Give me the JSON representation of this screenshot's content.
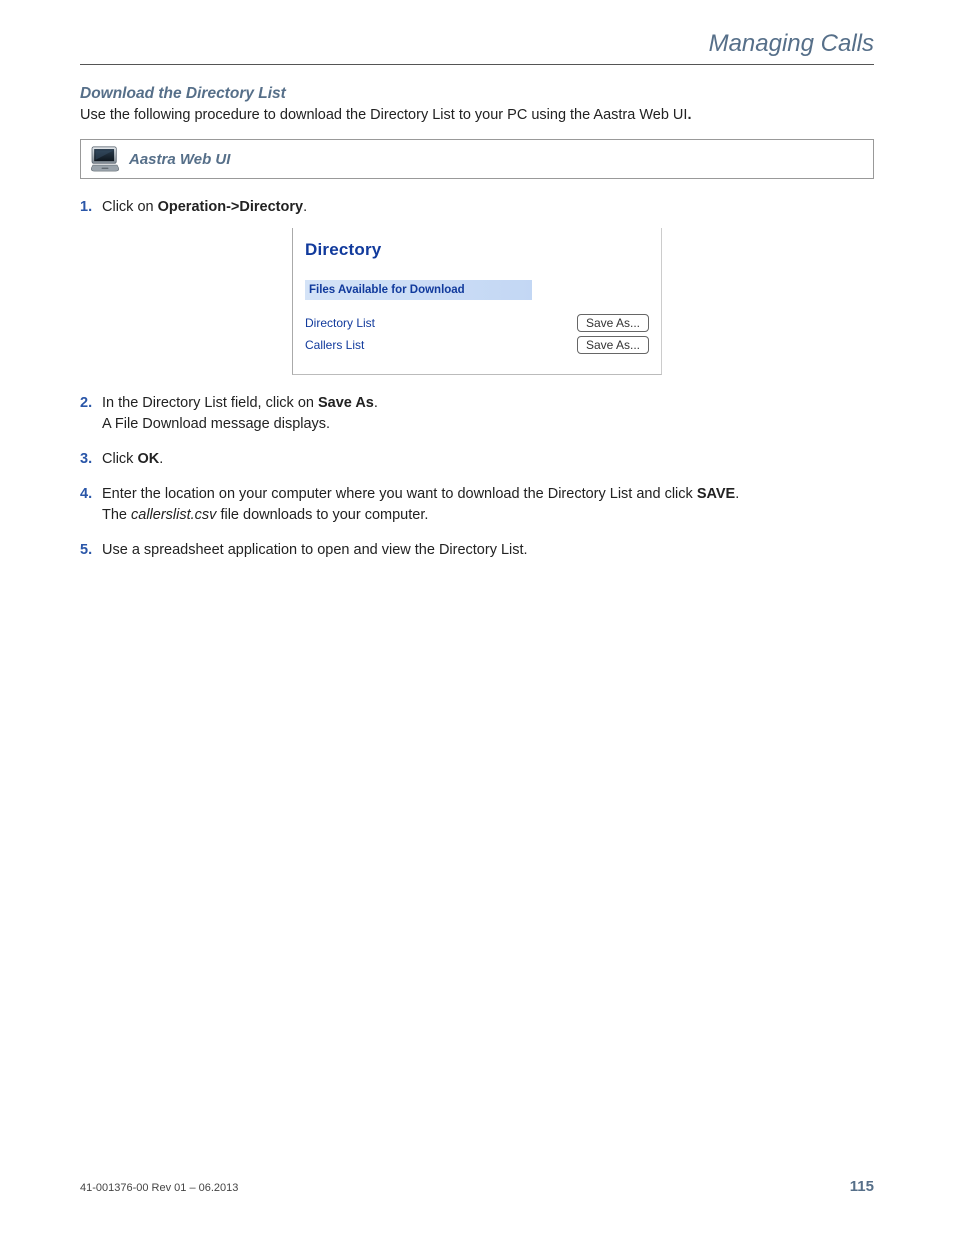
{
  "header": {
    "chapter_title": "Managing Calls"
  },
  "section": {
    "title": "Download the Directory List",
    "intro_start": "Use the following procedure to download the Directory List to your PC using the Aastra Web UI",
    "intro_end": "."
  },
  "callout": {
    "label": "Aastra Web UI"
  },
  "steps": {
    "s1": {
      "pre": "Click on ",
      "bold": "Operation->Directory",
      "post": "."
    },
    "s2": {
      "pre": "In the Directory List field, click on ",
      "bold": "Save As",
      "post1": ".",
      "line2": "A File Download message displays."
    },
    "s3": {
      "pre": "Click ",
      "bold": "OK",
      "post": "."
    },
    "s4": {
      "pre": "Enter the location on your computer where you want to download the Directory List and click ",
      "bold": "SAVE",
      "post": ".",
      "line2a": "The ",
      "filename": "callerslist.csv",
      "line2b": " file downloads to your computer."
    },
    "s5": {
      "text": "Use a spreadsheet application to open and view the Directory List."
    }
  },
  "screenshot": {
    "heading": "Directory",
    "subheading": "Files Available for Download",
    "rows": [
      {
        "label": "Directory List",
        "button": "Save As..."
      },
      {
        "label": "Callers List",
        "button": "Save As..."
      }
    ]
  },
  "footer": {
    "docid": "41-001376-00 Rev 01 – 06.2013",
    "page": "115"
  }
}
